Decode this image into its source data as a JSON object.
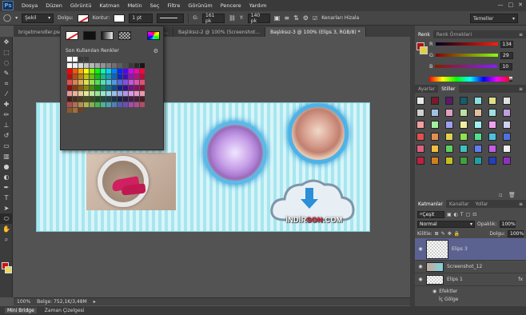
{
  "app": {
    "logo": "Ps"
  },
  "menu": [
    "Dosya",
    "Düzen",
    "Görüntü",
    "Katman",
    "Metin",
    "Seç",
    "Filtre",
    "Görünüm",
    "Pencere",
    "Yardım"
  ],
  "window_controls": [
    "—",
    "□",
    "✕"
  ],
  "options": {
    "shape_mode": "Şekil",
    "fill_label": "Dolgu:",
    "stroke_label": "Kontur:",
    "stroke_size": "1 pt",
    "w_label": "G:",
    "w_value": "161 pk",
    "h_label": "Y:",
    "h_value": "140 pk",
    "align_edges": "Kenarları Hizala",
    "workspace": "Temeller"
  },
  "tabs": [
    {
      "label": "brigetmendler.psd",
      "active": false
    },
    {
      "label": "İ3, R...",
      "active": false
    },
    {
      "label": "Başlıksız-2 @ 100% (Screenshot...",
      "active": false
    },
    {
      "label": "Başlıksız-3 @ 100% (Elips 3, RGB/8) *",
      "active": true
    }
  ],
  "swatch_popup": {
    "title": "Son Kullanılan Renkler"
  },
  "canvas": {
    "cloud_text_a": "İNDİR",
    "cloud_text_b": "SON",
    "cloud_text_c": ".COM"
  },
  "status": {
    "zoom": "100%",
    "doc_size": "Belge: 752,1K/3,48M"
  },
  "bottom_tabs": [
    {
      "label": "Mini Bridge",
      "active": true
    },
    {
      "label": "Zaman Çizelgesi",
      "active": false
    }
  ],
  "color_panel": {
    "tabs": [
      "Renk",
      "Renk Örnekleri"
    ],
    "r_label": "R",
    "r_value": "134",
    "g_label": "G",
    "g_value": "29",
    "b_label": "B",
    "b_value": "10"
  },
  "styles_panel": {
    "tabs": [
      "Ayarlar",
      "Stiller"
    ]
  },
  "layers_panel": {
    "tabs": [
      "Katmanlar",
      "Kanallar",
      "Yollar"
    ],
    "filter": "Çeşit",
    "blend_mode": "Normal",
    "opacity_label": "Opaklık:",
    "opacity_value": "100%",
    "lock_label": "Kilitle:",
    "fill_label": "Dolgu:",
    "fill_value": "100%",
    "layers": [
      {
        "name": "Elips 3",
        "active": true
      },
      {
        "name": "Screenshot_12",
        "active": false
      },
      {
        "name": "Elips 1",
        "active": false,
        "fx": "fx"
      }
    ],
    "effects_label": "Efektler",
    "shadow_label": "İç Gölge"
  }
}
